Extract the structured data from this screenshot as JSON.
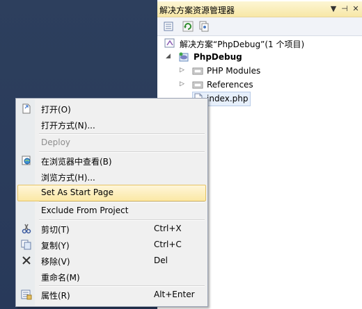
{
  "solution_explorer": {
    "title": "解决方案资源管理器",
    "title_buttons": [
      "▼",
      "⊣",
      "✕"
    ],
    "toolbar_icons": [
      "properties-icon",
      "refresh-icon",
      "show-all-files-icon"
    ],
    "tree": {
      "solution_label": "解决方案“PhpDebug”(1 个项目)",
      "project_label": "PhpDebug",
      "children": [
        {
          "label": "PHP Modules"
        },
        {
          "label": "References"
        },
        {
          "label": "index.php"
        }
      ]
    }
  },
  "context_menu": {
    "items": [
      {
        "label": "打开(O)",
        "shortcut": "",
        "icon": "open-icon",
        "disabled": false
      },
      {
        "label": "打开方式(N)...",
        "shortcut": "",
        "icon": "",
        "disabled": false
      },
      {
        "label": "Deploy",
        "shortcut": "",
        "icon": "",
        "disabled": true
      },
      {
        "label": "在浏览器中查看(B)",
        "shortcut": "",
        "icon": "view-in-browser-icon",
        "disabled": false
      },
      {
        "label": "浏览方式(H)...",
        "shortcut": "",
        "icon": "",
        "disabled": false
      },
      {
        "label": "Set As Start Page",
        "shortcut": "",
        "icon": "",
        "disabled": false,
        "highlighted": true
      },
      {
        "label": "Exclude From Project",
        "shortcut": "",
        "icon": "",
        "disabled": false
      },
      {
        "label": "剪切(T)",
        "shortcut": "Ctrl+X",
        "icon": "cut-icon",
        "disabled": false
      },
      {
        "label": "复制(Y)",
        "shortcut": "Ctrl+C",
        "icon": "copy-icon",
        "disabled": false
      },
      {
        "label": "移除(V)",
        "shortcut": "Del",
        "icon": "remove-icon",
        "disabled": false
      },
      {
        "label": "重命名(M)",
        "shortcut": "",
        "icon": "",
        "disabled": false
      },
      {
        "label": "属性(R)",
        "shortcut": "Alt+Enter",
        "icon": "properties-icon",
        "disabled": false
      }
    ]
  }
}
